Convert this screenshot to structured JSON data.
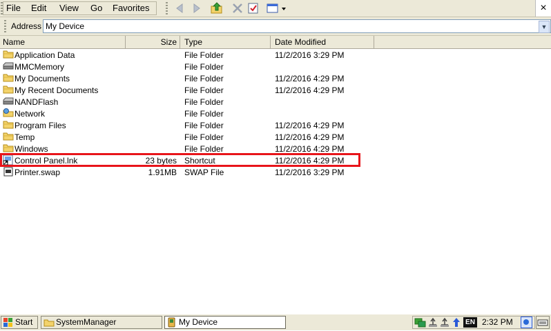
{
  "menu": {
    "file": "File",
    "edit": "Edit",
    "view": "View",
    "go": "Go",
    "favorites": "Favorites"
  },
  "toolbar": {
    "back_icon": "back-arrow-icon",
    "forward_icon": "forward-arrow-icon",
    "up_icon": "folder-up-icon",
    "delete_icon": "delete-x-icon",
    "properties_icon": "properties-check-icon",
    "views_icon": "views-menu-icon",
    "close": "×"
  },
  "address": {
    "label": "Address",
    "value": "My Device"
  },
  "columns": {
    "name": "Name",
    "size": "Size",
    "type": "Type",
    "date": "Date Modified"
  },
  "files": [
    {
      "name": "Application Data",
      "size": "",
      "type": "File Folder",
      "date": "11/2/2016 3:29 PM",
      "icon": "folder"
    },
    {
      "name": "MMCMemory",
      "size": "",
      "type": "File Folder",
      "date": "",
      "icon": "drive"
    },
    {
      "name": "My Documents",
      "size": "",
      "type": "File Folder",
      "date": "11/2/2016 4:29 PM",
      "icon": "folder"
    },
    {
      "name": "My Recent Documents",
      "size": "",
      "type": "File Folder",
      "date": "11/2/2016 4:29 PM",
      "icon": "folder"
    },
    {
      "name": "NANDFlash",
      "size": "",
      "type": "File Folder",
      "date": "",
      "icon": "drive"
    },
    {
      "name": "Network",
      "size": "",
      "type": "File Folder",
      "date": "",
      "icon": "network"
    },
    {
      "name": "Program Files",
      "size": "",
      "type": "File Folder",
      "date": "11/2/2016 4:29 PM",
      "icon": "folder"
    },
    {
      "name": "Temp",
      "size": "",
      "type": "File Folder",
      "date": "11/2/2016 4:29 PM",
      "icon": "folder"
    },
    {
      "name": "Windows",
      "size": "",
      "type": "File Folder",
      "date": "11/2/2016 4:29 PM",
      "icon": "folder"
    },
    {
      "name": "Control Panel.lnk",
      "size": "23 bytes",
      "type": "Shortcut",
      "date": "11/2/2016 4:29 PM",
      "icon": "shortcut"
    },
    {
      "name": "Printer.swap",
      "size": "1.91MB",
      "type": "SWAP File",
      "date": "11/2/2016 3:29 PM",
      "icon": "file"
    }
  ],
  "taskbar": {
    "start": "Start",
    "task1": "SystemManager",
    "task2": "My Device",
    "lang": "EN",
    "time": "2:32 PM"
  },
  "colors": {
    "highlight": "#e8141a",
    "folder": "#f3d36b",
    "chrome": "#ece9d8"
  }
}
